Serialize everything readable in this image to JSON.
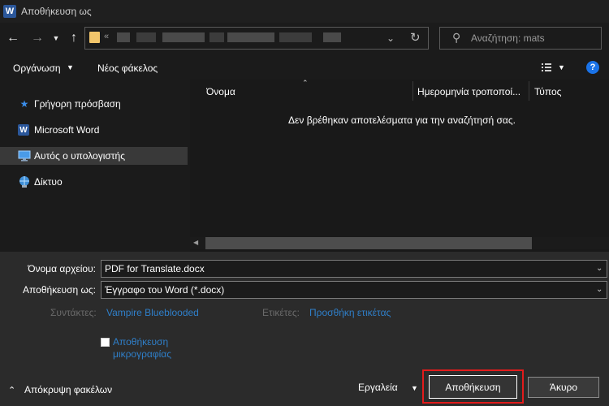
{
  "window": {
    "title": "Αποθήκευση ως",
    "app_icon": "W"
  },
  "address": {
    "prefix": "«"
  },
  "search": {
    "placeholder": "Αναζήτηση: mats"
  },
  "toolbar": {
    "organize_label": "Οργάνωση",
    "new_folder_label": "Νέος φάκελος",
    "help_label": "?"
  },
  "nav": {
    "items": [
      {
        "label": "Γρήγορη πρόσβαση",
        "icon": "star-icon"
      },
      {
        "label": "Microsoft Word",
        "icon": "word-icon"
      },
      {
        "label": "Αυτός ο υπολογιστής",
        "icon": "computer-icon",
        "selected": true
      },
      {
        "label": "Δίκτυο",
        "icon": "network-icon"
      }
    ]
  },
  "columns": [
    {
      "label": "Όνομα"
    },
    {
      "label": "Ημερομηνία τροποποί..."
    },
    {
      "label": "Τύπος"
    }
  ],
  "empty_message": "Δεν βρέθηκαν αποτελέσματα για την αναζήτησή σας.",
  "form": {
    "filename_label": "Όνομα αρχείου:",
    "filename_value": "PDF for Translate.docx",
    "savetype_label": "Αποθήκευση ως:",
    "savetype_value": "Έγγραφο του Word (*.docx)",
    "authors_label": "Συντάκτες:",
    "authors_value": "Vampire Blueblooded",
    "tags_label": "Ετικέτες:",
    "tags_value": "Προσθήκη ετικέτας",
    "thumbnail_label": "Αποθήκευση μικρογραφίας"
  },
  "footer": {
    "hide_folders_label": "Απόκρυψη φακέλων",
    "tools_label": "Εργαλεία",
    "save_label": "Αποθήκευση",
    "cancel_label": "Άκυρο"
  },
  "colors": {
    "accent": "#1a73e8",
    "link": "#2f7fc9",
    "highlight": "#e21b1b",
    "word_blue": "#2b579a"
  }
}
